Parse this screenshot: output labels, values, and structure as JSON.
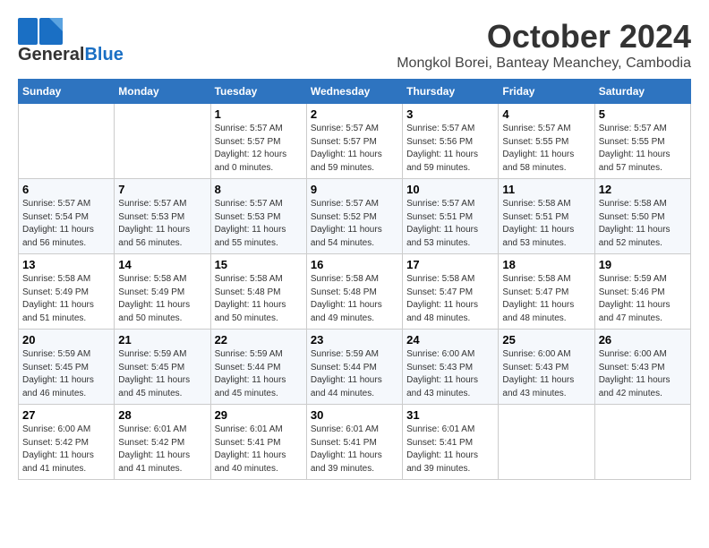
{
  "logo": {
    "general": "General",
    "blue": "Blue"
  },
  "header": {
    "month": "October 2024",
    "location": "Mongkol Borei, Banteay Meanchey, Cambodia"
  },
  "weekdays": [
    "Sunday",
    "Monday",
    "Tuesday",
    "Wednesday",
    "Thursday",
    "Friday",
    "Saturday"
  ],
  "weeks": [
    [
      {
        "day": "",
        "sunrise": "",
        "sunset": "",
        "daylight": ""
      },
      {
        "day": "",
        "sunrise": "",
        "sunset": "",
        "daylight": ""
      },
      {
        "day": "1",
        "sunrise": "Sunrise: 5:57 AM",
        "sunset": "Sunset: 5:57 PM",
        "daylight": "Daylight: 12 hours and 0 minutes."
      },
      {
        "day": "2",
        "sunrise": "Sunrise: 5:57 AM",
        "sunset": "Sunset: 5:57 PM",
        "daylight": "Daylight: 11 hours and 59 minutes."
      },
      {
        "day": "3",
        "sunrise": "Sunrise: 5:57 AM",
        "sunset": "Sunset: 5:56 PM",
        "daylight": "Daylight: 11 hours and 59 minutes."
      },
      {
        "day": "4",
        "sunrise": "Sunrise: 5:57 AM",
        "sunset": "Sunset: 5:55 PM",
        "daylight": "Daylight: 11 hours and 58 minutes."
      },
      {
        "day": "5",
        "sunrise": "Sunrise: 5:57 AM",
        "sunset": "Sunset: 5:55 PM",
        "daylight": "Daylight: 11 hours and 57 minutes."
      }
    ],
    [
      {
        "day": "6",
        "sunrise": "Sunrise: 5:57 AM",
        "sunset": "Sunset: 5:54 PM",
        "daylight": "Daylight: 11 hours and 56 minutes."
      },
      {
        "day": "7",
        "sunrise": "Sunrise: 5:57 AM",
        "sunset": "Sunset: 5:53 PM",
        "daylight": "Daylight: 11 hours and 56 minutes."
      },
      {
        "day": "8",
        "sunrise": "Sunrise: 5:57 AM",
        "sunset": "Sunset: 5:53 PM",
        "daylight": "Daylight: 11 hours and 55 minutes."
      },
      {
        "day": "9",
        "sunrise": "Sunrise: 5:57 AM",
        "sunset": "Sunset: 5:52 PM",
        "daylight": "Daylight: 11 hours and 54 minutes."
      },
      {
        "day": "10",
        "sunrise": "Sunrise: 5:57 AM",
        "sunset": "Sunset: 5:51 PM",
        "daylight": "Daylight: 11 hours and 53 minutes."
      },
      {
        "day": "11",
        "sunrise": "Sunrise: 5:58 AM",
        "sunset": "Sunset: 5:51 PM",
        "daylight": "Daylight: 11 hours and 53 minutes."
      },
      {
        "day": "12",
        "sunrise": "Sunrise: 5:58 AM",
        "sunset": "Sunset: 5:50 PM",
        "daylight": "Daylight: 11 hours and 52 minutes."
      }
    ],
    [
      {
        "day": "13",
        "sunrise": "Sunrise: 5:58 AM",
        "sunset": "Sunset: 5:49 PM",
        "daylight": "Daylight: 11 hours and 51 minutes."
      },
      {
        "day": "14",
        "sunrise": "Sunrise: 5:58 AM",
        "sunset": "Sunset: 5:49 PM",
        "daylight": "Daylight: 11 hours and 50 minutes."
      },
      {
        "day": "15",
        "sunrise": "Sunrise: 5:58 AM",
        "sunset": "Sunset: 5:48 PM",
        "daylight": "Daylight: 11 hours and 50 minutes."
      },
      {
        "day": "16",
        "sunrise": "Sunrise: 5:58 AM",
        "sunset": "Sunset: 5:48 PM",
        "daylight": "Daylight: 11 hours and 49 minutes."
      },
      {
        "day": "17",
        "sunrise": "Sunrise: 5:58 AM",
        "sunset": "Sunset: 5:47 PM",
        "daylight": "Daylight: 11 hours and 48 minutes."
      },
      {
        "day": "18",
        "sunrise": "Sunrise: 5:58 AM",
        "sunset": "Sunset: 5:47 PM",
        "daylight": "Daylight: 11 hours and 48 minutes."
      },
      {
        "day": "19",
        "sunrise": "Sunrise: 5:59 AM",
        "sunset": "Sunset: 5:46 PM",
        "daylight": "Daylight: 11 hours and 47 minutes."
      }
    ],
    [
      {
        "day": "20",
        "sunrise": "Sunrise: 5:59 AM",
        "sunset": "Sunset: 5:45 PM",
        "daylight": "Daylight: 11 hours and 46 minutes."
      },
      {
        "day": "21",
        "sunrise": "Sunrise: 5:59 AM",
        "sunset": "Sunset: 5:45 PM",
        "daylight": "Daylight: 11 hours and 45 minutes."
      },
      {
        "day": "22",
        "sunrise": "Sunrise: 5:59 AM",
        "sunset": "Sunset: 5:44 PM",
        "daylight": "Daylight: 11 hours and 45 minutes."
      },
      {
        "day": "23",
        "sunrise": "Sunrise: 5:59 AM",
        "sunset": "Sunset: 5:44 PM",
        "daylight": "Daylight: 11 hours and 44 minutes."
      },
      {
        "day": "24",
        "sunrise": "Sunrise: 6:00 AM",
        "sunset": "Sunset: 5:43 PM",
        "daylight": "Daylight: 11 hours and 43 minutes."
      },
      {
        "day": "25",
        "sunrise": "Sunrise: 6:00 AM",
        "sunset": "Sunset: 5:43 PM",
        "daylight": "Daylight: 11 hours and 43 minutes."
      },
      {
        "day": "26",
        "sunrise": "Sunrise: 6:00 AM",
        "sunset": "Sunset: 5:43 PM",
        "daylight": "Daylight: 11 hours and 42 minutes."
      }
    ],
    [
      {
        "day": "27",
        "sunrise": "Sunrise: 6:00 AM",
        "sunset": "Sunset: 5:42 PM",
        "daylight": "Daylight: 11 hours and 41 minutes."
      },
      {
        "day": "28",
        "sunrise": "Sunrise: 6:01 AM",
        "sunset": "Sunset: 5:42 PM",
        "daylight": "Daylight: 11 hours and 41 minutes."
      },
      {
        "day": "29",
        "sunrise": "Sunrise: 6:01 AM",
        "sunset": "Sunset: 5:41 PM",
        "daylight": "Daylight: 11 hours and 40 minutes."
      },
      {
        "day": "30",
        "sunrise": "Sunrise: 6:01 AM",
        "sunset": "Sunset: 5:41 PM",
        "daylight": "Daylight: 11 hours and 39 minutes."
      },
      {
        "day": "31",
        "sunrise": "Sunrise: 6:01 AM",
        "sunset": "Sunset: 5:41 PM",
        "daylight": "Daylight: 11 hours and 39 minutes."
      },
      {
        "day": "",
        "sunrise": "",
        "sunset": "",
        "daylight": ""
      },
      {
        "day": "",
        "sunrise": "",
        "sunset": "",
        "daylight": ""
      }
    ]
  ]
}
